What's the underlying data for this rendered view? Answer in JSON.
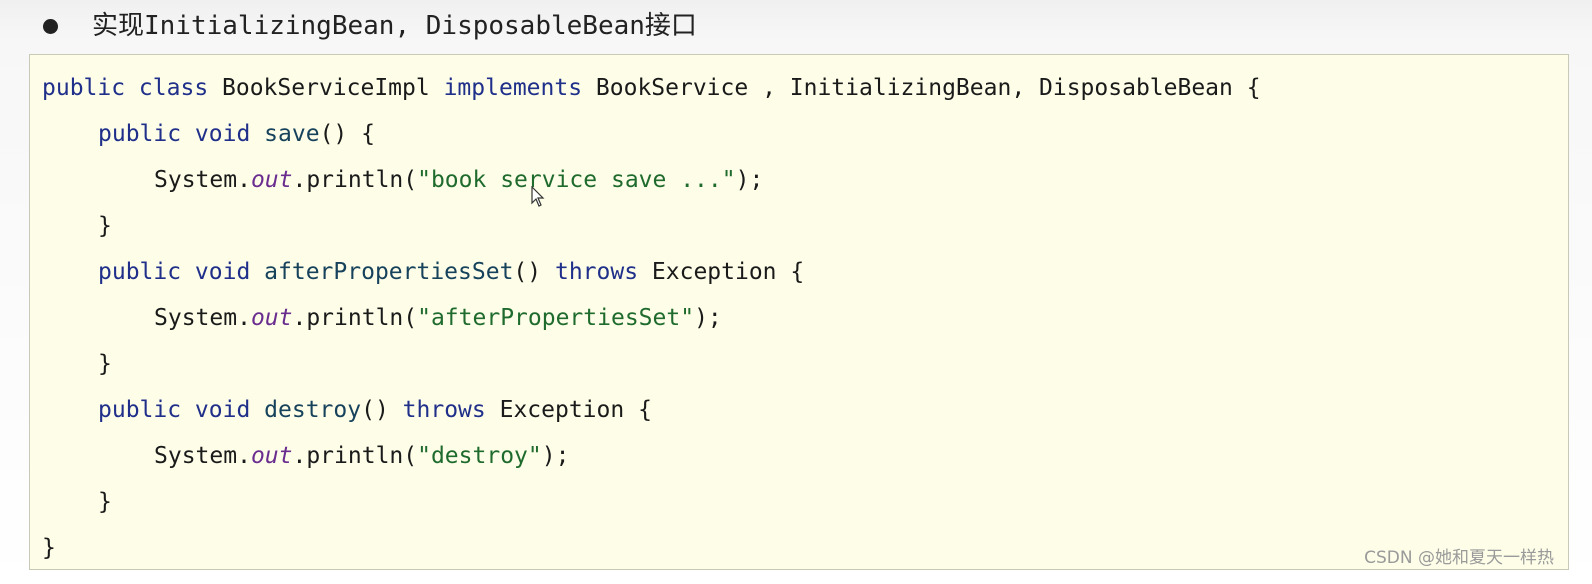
{
  "heading": {
    "bullet_text": "实现InitializingBean, DisposableBean接口"
  },
  "code": {
    "line1": {
      "kw1": "public class ",
      "class_name": "BookServiceImpl ",
      "kw2": "implements ",
      "interfaces": "BookService , InitializingBean, DisposableBean {"
    },
    "line2": {
      "kw": "public void ",
      "method": "save",
      "rest": "() {"
    },
    "line3": {
      "obj": "System.",
      "field": "out",
      "call": ".println(",
      "str": "\"book service save ...\"",
      "end": ");"
    },
    "line4": {
      "brace": "}"
    },
    "line5": {
      "kw": "public void ",
      "method": "afterPropertiesSet",
      "paren": "() ",
      "throws": "throws ",
      "rest": "Exception {"
    },
    "line6": {
      "obj": "System.",
      "field": "out",
      "call": ".println(",
      "str": "\"afterPropertiesSet\"",
      "end": ");"
    },
    "line7": {
      "brace": "}"
    },
    "line8": {
      "kw": "public void ",
      "method": "destroy",
      "paren": "() ",
      "throws": "throws ",
      "rest": "Exception {"
    },
    "line9": {
      "obj": "System.",
      "field": "out",
      "call": ".println(",
      "str": "\"destroy\"",
      "end": ");"
    },
    "line10": {
      "brace": "}"
    },
    "line11": {
      "brace": "}"
    }
  },
  "watermark": "CSDN @她和夏天一样热"
}
